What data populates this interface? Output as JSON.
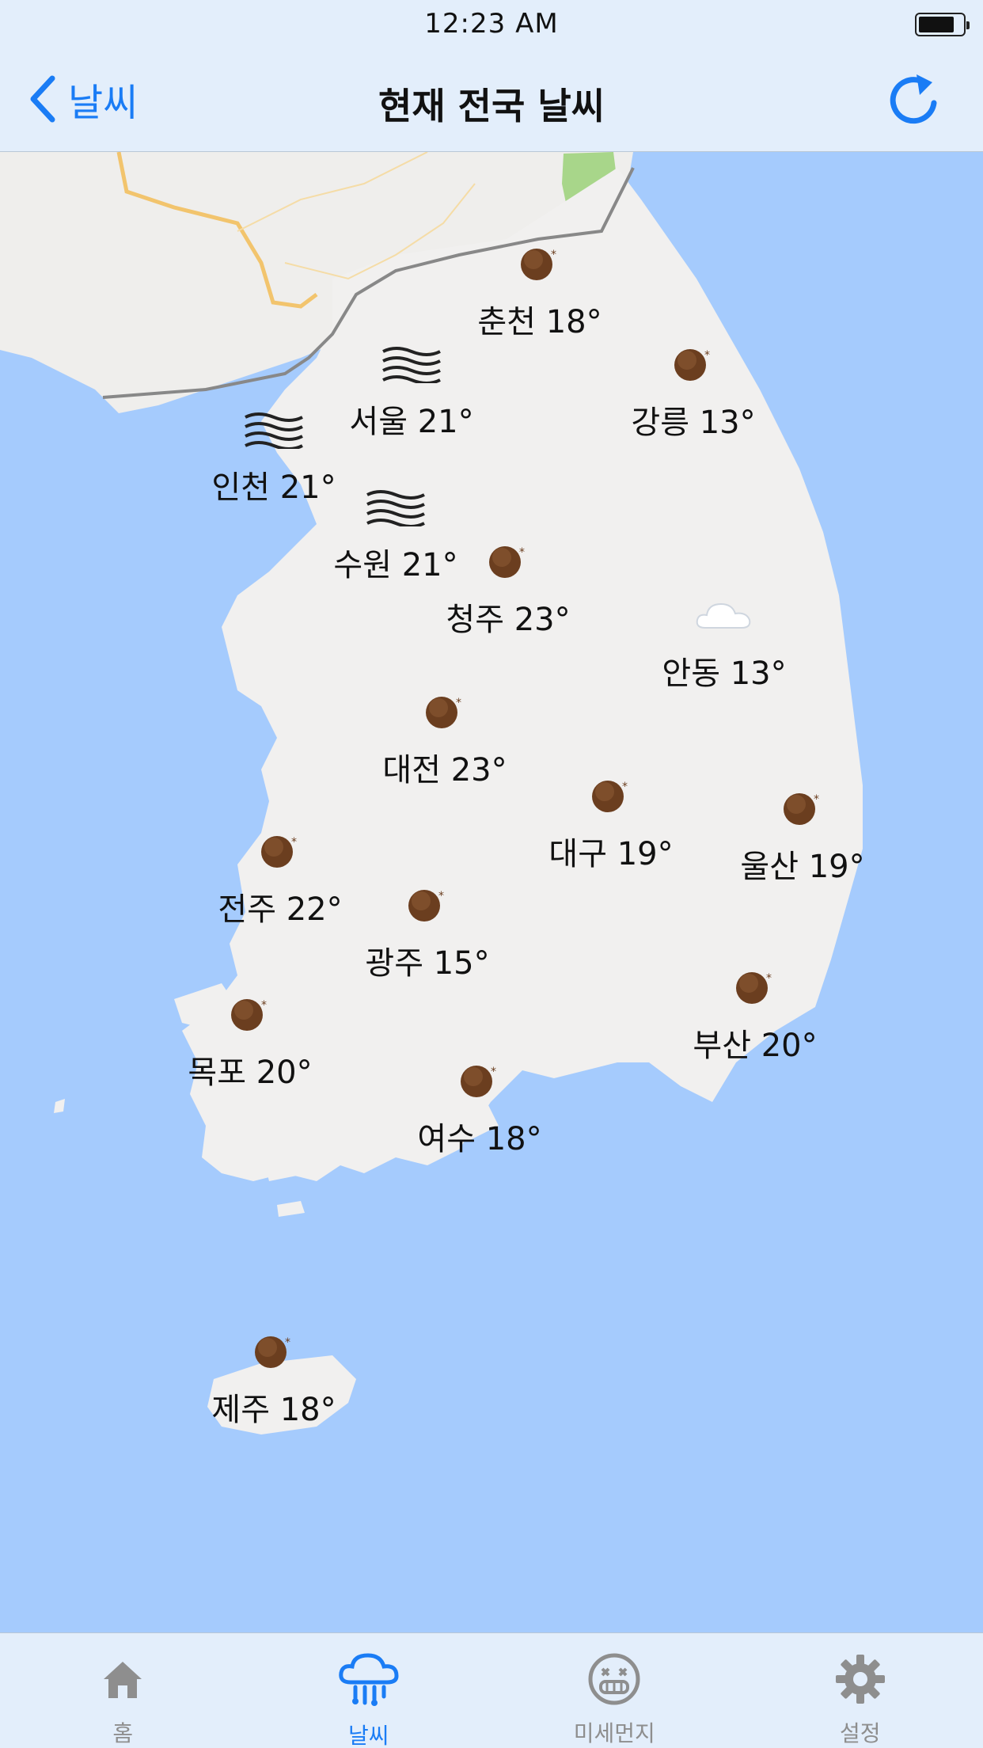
{
  "status_bar": {
    "time": "12:23 AM"
  },
  "nav": {
    "back_label": "날씨",
    "title": "현재 전국 날씨"
  },
  "cities": [
    {
      "name": "춘천",
      "temp": "18°",
      "label": "춘천 18°",
      "icon": "moon-icon"
    },
    {
      "name": "서울",
      "temp": "21°",
      "label": "서울 21°",
      "icon": "haze-icon"
    },
    {
      "name": "강릉",
      "temp": "13°",
      "label": "강릉 13°",
      "icon": "moon-icon"
    },
    {
      "name": "인천",
      "temp": "21°",
      "label": "인천 21°",
      "icon": "haze-icon"
    },
    {
      "name": "수원",
      "temp": "21°",
      "label": "수원 21°",
      "icon": "haze-icon"
    },
    {
      "name": "청주",
      "temp": "23°",
      "label": "청주 23°",
      "icon": "moon-icon"
    },
    {
      "name": "안동",
      "temp": "13°",
      "label": "안동 13°",
      "icon": "cloud-icon"
    },
    {
      "name": "대전",
      "temp": "23°",
      "label": "대전 23°",
      "icon": "moon-icon"
    },
    {
      "name": "대구",
      "temp": "19°",
      "label": "대구 19°",
      "icon": "moon-icon"
    },
    {
      "name": "울산",
      "temp": "19°",
      "label": "울산 19°",
      "icon": "moon-icon"
    },
    {
      "name": "전주",
      "temp": "22°",
      "label": "전주 22°",
      "icon": "moon-icon"
    },
    {
      "name": "광주",
      "temp": "15°",
      "label": "광주 15°",
      "icon": "moon-icon"
    },
    {
      "name": "부산",
      "temp": "20°",
      "label": "부산 20°",
      "icon": "moon-icon"
    },
    {
      "name": "목포",
      "temp": "20°",
      "label": "목포 20°",
      "icon": "moon-icon"
    },
    {
      "name": "여수",
      "temp": "18°",
      "label": "여수 18°",
      "icon": "moon-icon"
    },
    {
      "name": "제주",
      "temp": "18°",
      "label": "제주 18°",
      "icon": "moon-icon"
    }
  ],
  "tabs": [
    {
      "label": "홈",
      "icon": "home-icon",
      "active": false
    },
    {
      "label": "날씨",
      "icon": "weather-rain-icon",
      "active": true
    },
    {
      "label": "미세먼지",
      "icon": "dust-mask-icon",
      "active": false
    },
    {
      "label": "설정",
      "icon": "gear-icon",
      "active": false
    }
  ],
  "colors": {
    "accent": "#1a7cf5",
    "sea": "#a5cbfd",
    "land": "#f1f0ef",
    "bar": "#e3eefb",
    "tab_inactive": "#8e8e8e"
  }
}
